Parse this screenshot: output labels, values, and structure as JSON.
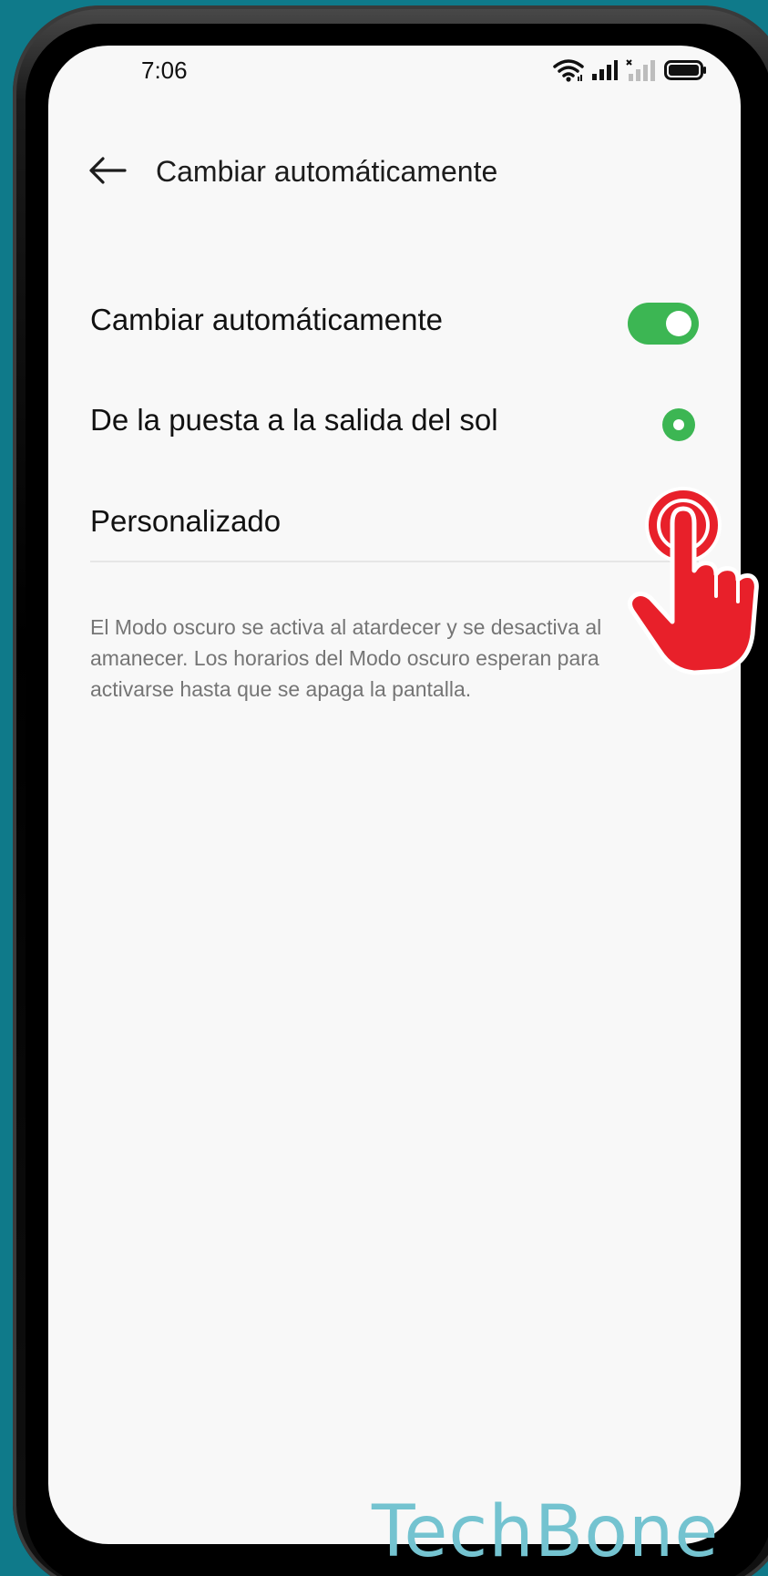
{
  "status_bar": {
    "time": "7:06",
    "icons": [
      "wifi-icon",
      "signal-icon",
      "signal-no-service-icon",
      "battery-icon"
    ]
  },
  "header": {
    "back_icon": "arrow-left-icon",
    "title": "Cambiar automáticamente"
  },
  "settings": {
    "auto_switch": {
      "label": "Cambiar automáticamente",
      "enabled": true
    },
    "options": [
      {
        "label": "De la puesta a la salida del sol",
        "selected": true
      },
      {
        "label": "Personalizado",
        "selected": false
      }
    ],
    "description": "El Modo oscuro se activa al atardecer y se desactiva al amanecer. Los horarios del Modo oscuro esperan para activarse hasta que se apaga la pantalla."
  },
  "overlay": {
    "watermark": "TechBone",
    "tap_indicator_icon": "tap-hand-icon"
  },
  "colors": {
    "accent": "#3cb653",
    "background": "#0f7a8a",
    "screen": "#f8f8f8",
    "tap_indicator": "#e8202a",
    "watermark": "#74c3d0"
  }
}
